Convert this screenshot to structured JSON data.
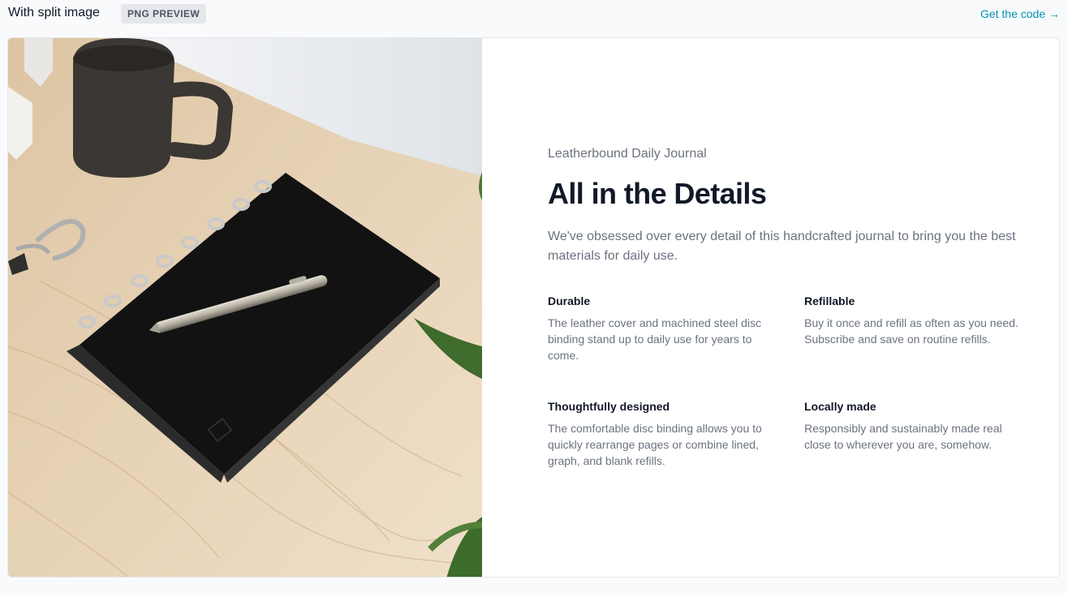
{
  "header": {
    "title": "With split image",
    "badge": "PNG PREVIEW",
    "get_code_label": "Get the code →"
  },
  "product": {
    "eyebrow": "Leatherbound Daily Journal",
    "heading": "All in the Details",
    "lead": "We've obsessed over every detail of this handcrafted journal to bring you the best materials for daily use."
  },
  "features": [
    {
      "title": "Durable",
      "description": "The leather cover and machined steel disc binding stand up to daily use for years to come."
    },
    {
      "title": "Refillable",
      "description": "Buy it once and refill as often as you need. Subscribe and save on routine refills."
    },
    {
      "title": "Thoughtfully designed",
      "description": "The comfortable disc binding allows you to quickly rearrange pages or combine lined, graph, and blank refills."
    },
    {
      "title": "Locally made",
      "description": "Responsibly and sustainably made real close to wherever you are, somehow."
    }
  ],
  "colors": {
    "accent": "#0891b2",
    "heading": "#111827",
    "muted": "#6b7280",
    "badge_bg": "#e5e7eb"
  }
}
